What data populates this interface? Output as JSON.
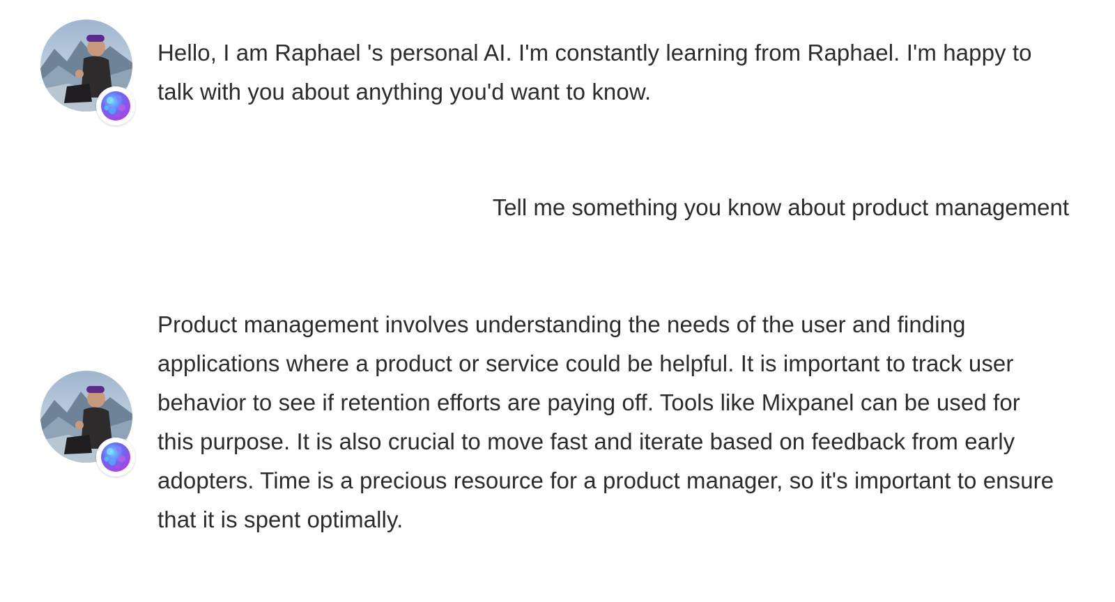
{
  "chat": {
    "messages": [
      {
        "role": "ai",
        "avatar_icon": "user-portrait-avatar",
        "badge_icon": "ai-orb-badge-icon",
        "text": "Hello, I am Raphael 's personal AI. I'm constantly learning from Raphael. I'm happy to talk with you about anything you'd want to know."
      },
      {
        "role": "user",
        "text": "Tell me something you know about product management"
      },
      {
        "role": "ai",
        "avatar_icon": "user-portrait-avatar",
        "badge_icon": "ai-orb-badge-icon",
        "text": "Product management involves understanding the needs of the user and finding applications where a product or service could be helpful. It is important to track user behavior to see if retention efforts are paying off. Tools like Mixpanel can be used for this purpose. It is also crucial to move fast and iterate based on feedback from early adopters. Time is a precious resource for a product manager, so it's important to ensure that it is spent optimally."
      }
    ]
  },
  "colors": {
    "text": "#2b2b2b",
    "background": "#ffffff",
    "badge_orb_start": "#3aa8f0",
    "badge_orb_end": "#b23ce0"
  }
}
